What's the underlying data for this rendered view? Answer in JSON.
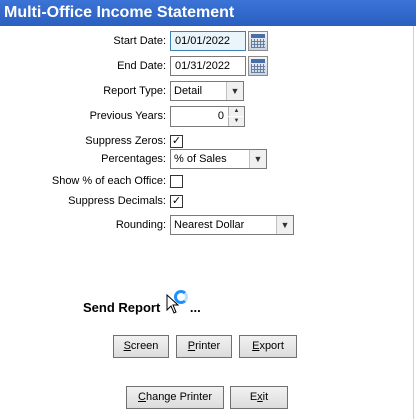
{
  "window": {
    "title": "Multi-Office Income Statement"
  },
  "form": {
    "start_date": {
      "label": "Start Date:",
      "value": "01/01/2022"
    },
    "end_date": {
      "label": "End Date:",
      "value": "01/31/2022"
    },
    "report_type": {
      "label": "Report Type:",
      "value": "Detail"
    },
    "previous_years": {
      "label": "Previous Years:",
      "value": "0"
    },
    "suppress_zeros": {
      "label": "Suppress Zeros:",
      "checked": true,
      "mark": "✓"
    },
    "percentages": {
      "label": "Percentages:",
      "value": "% of Sales"
    },
    "show_pct_office": {
      "label": "Show % of each Office:",
      "checked": false,
      "mark": ""
    },
    "suppress_decimals": {
      "label": "Suppress Decimals:",
      "checked": true,
      "mark": "✓"
    },
    "rounding": {
      "label": "Rounding:",
      "value": "Nearest Dollar"
    }
  },
  "send_report": {
    "label": "Send Report",
    "suffix": "..."
  },
  "buttons": {
    "screen_u": "S",
    "screen_rest": "creen",
    "printer_u": "P",
    "printer_rest": "rinter",
    "export_u": "E",
    "export_rest": "xport",
    "change_printer_u": "C",
    "change_printer_rest": "hange Printer",
    "exit_pre": "E",
    "exit_u": "x",
    "exit_rest": "it"
  },
  "icons": {
    "calendar": "calendar-icon",
    "dropdown": "chevron-down-icon",
    "spin": "spin-arrows-icon",
    "busy": "busy-cursor-icon"
  },
  "colors": {
    "titlebar": "#2a5fbf",
    "focus_field": "#eaf4fb",
    "busy_ring": "#1e90ff"
  }
}
